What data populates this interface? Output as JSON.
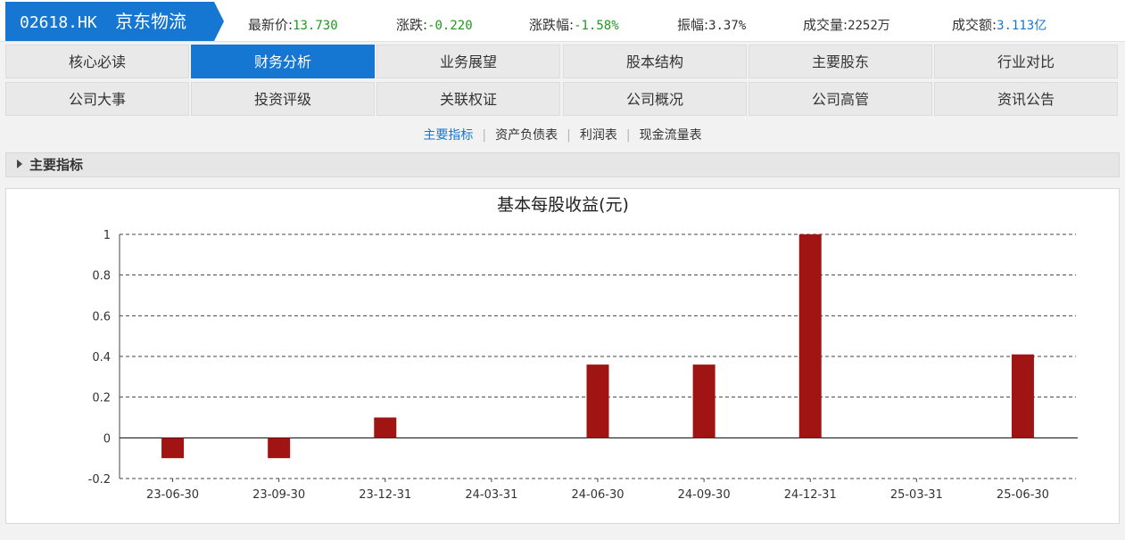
{
  "header": {
    "code": "02618.HK",
    "name": "京东物流",
    "quotes": [
      {
        "label": "最新价:",
        "value": "13.730",
        "color": "#1c9a1c"
      },
      {
        "label": "涨跌:",
        "value": "-0.220",
        "color": "#1c9a1c"
      },
      {
        "label": "涨跌幅:",
        "value": "-1.58%",
        "color": "#1c9a1c"
      },
      {
        "label": "振幅:",
        "value": "3.37%",
        "color": "#333333"
      },
      {
        "label": "成交量:",
        "value": "2252万",
        "color": "#333333"
      },
      {
        "label": "成交额:",
        "value": "3.113亿",
        "color": "#1577d2"
      }
    ]
  },
  "tabs": {
    "row1": [
      "核心必读",
      "财务分析",
      "业务展望",
      "股本结构",
      "主要股东",
      "行业对比"
    ],
    "row2": [
      "公司大事",
      "投资评级",
      "关联权证",
      "公司概况",
      "公司高管",
      "资讯公告"
    ],
    "active": "财务分析"
  },
  "subnav": {
    "items": [
      "主要指标",
      "资产负债表",
      "利润表",
      "现金流量表"
    ],
    "active": "主要指标"
  },
  "section": {
    "title": "主要指标"
  },
  "chart_data": {
    "type": "bar",
    "title": "基本每股收益(元)",
    "categories": [
      "23-06-30",
      "23-09-30",
      "23-12-31",
      "24-03-31",
      "24-06-30",
      "24-09-30",
      "24-12-31",
      "25-03-31",
      "25-06-30"
    ],
    "values": [
      -0.1,
      -0.1,
      0.1,
      0,
      0.36,
      0.36,
      1.0,
      0,
      0.41
    ],
    "ylim": [
      -0.2,
      1
    ],
    "yticks": [
      1,
      0.8,
      0.6,
      0.4,
      0.2,
      0,
      -0.2
    ],
    "ytick_labels": [
      "1",
      "0.8",
      "0.6",
      "0.4",
      "0.2",
      "0",
      "-0.2"
    ],
    "grid": true,
    "bar_color": "#a01513",
    "xlabel": "",
    "ylabel": ""
  },
  "colors": {
    "accent": "#1577d2",
    "down": "#1c9a1c"
  }
}
